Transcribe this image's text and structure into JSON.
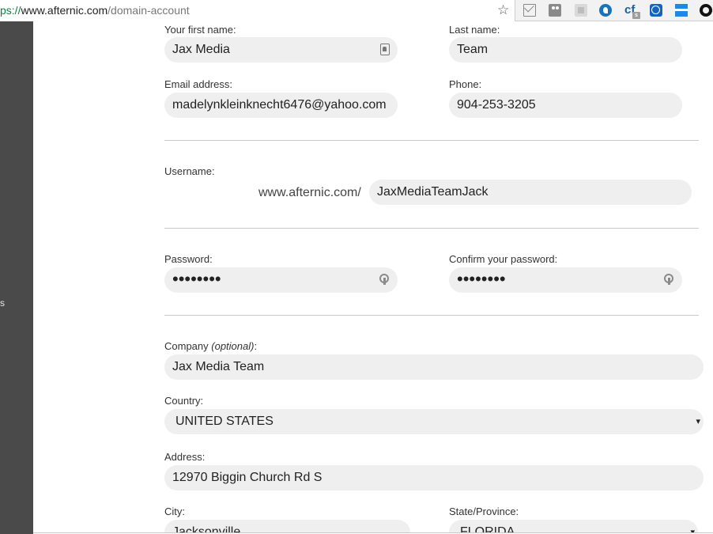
{
  "browser": {
    "url_scheme": "ps://",
    "url_host": "www.afternic.com",
    "url_path": "/domain-account",
    "extensions": [
      "mail-icon",
      "people-icon",
      "pages-icon",
      "bird-icon",
      "cf-icon",
      "compass-icon",
      "menu-icon",
      "chat-icon"
    ],
    "cf_label": "cf",
    "cf_badge": "s"
  },
  "sidebar": {
    "fragment": "s"
  },
  "form": {
    "first_name": {
      "label": "Your first name:",
      "value": "Jax Media"
    },
    "last_name": {
      "label": "Last name:",
      "value": "Team"
    },
    "email": {
      "label": "Email address:",
      "value": "madelynkleinknecht6476@yahoo.com"
    },
    "phone": {
      "label": "Phone:",
      "value": "904-253-3205"
    },
    "username": {
      "label": "Username:",
      "prefix": "www.afternic.com/",
      "value": "JaxMediaTeamJack"
    },
    "password": {
      "label": "Password:",
      "value": "••••••••"
    },
    "confirm_password": {
      "label": "Confirm your password:",
      "value": "••••••••"
    },
    "company": {
      "label": "Company",
      "optional": "(optional)",
      "colon": ":",
      "value": "Jax Media Team"
    },
    "country": {
      "label": "Country:",
      "value": "UNITED STATES",
      "arrow": "▾"
    },
    "address": {
      "label": "Address:",
      "value": "12970 Biggin Church Rd S"
    },
    "city": {
      "label": "City:",
      "value": "Jacksonville"
    },
    "state": {
      "label": "State/Province:",
      "value": "FLORIDA",
      "arrow": "▾"
    }
  },
  "colors": {
    "field_bg": "#f0efef",
    "sidebar_bg": "#4a4a4a",
    "url_scheme": "#0b8043"
  }
}
